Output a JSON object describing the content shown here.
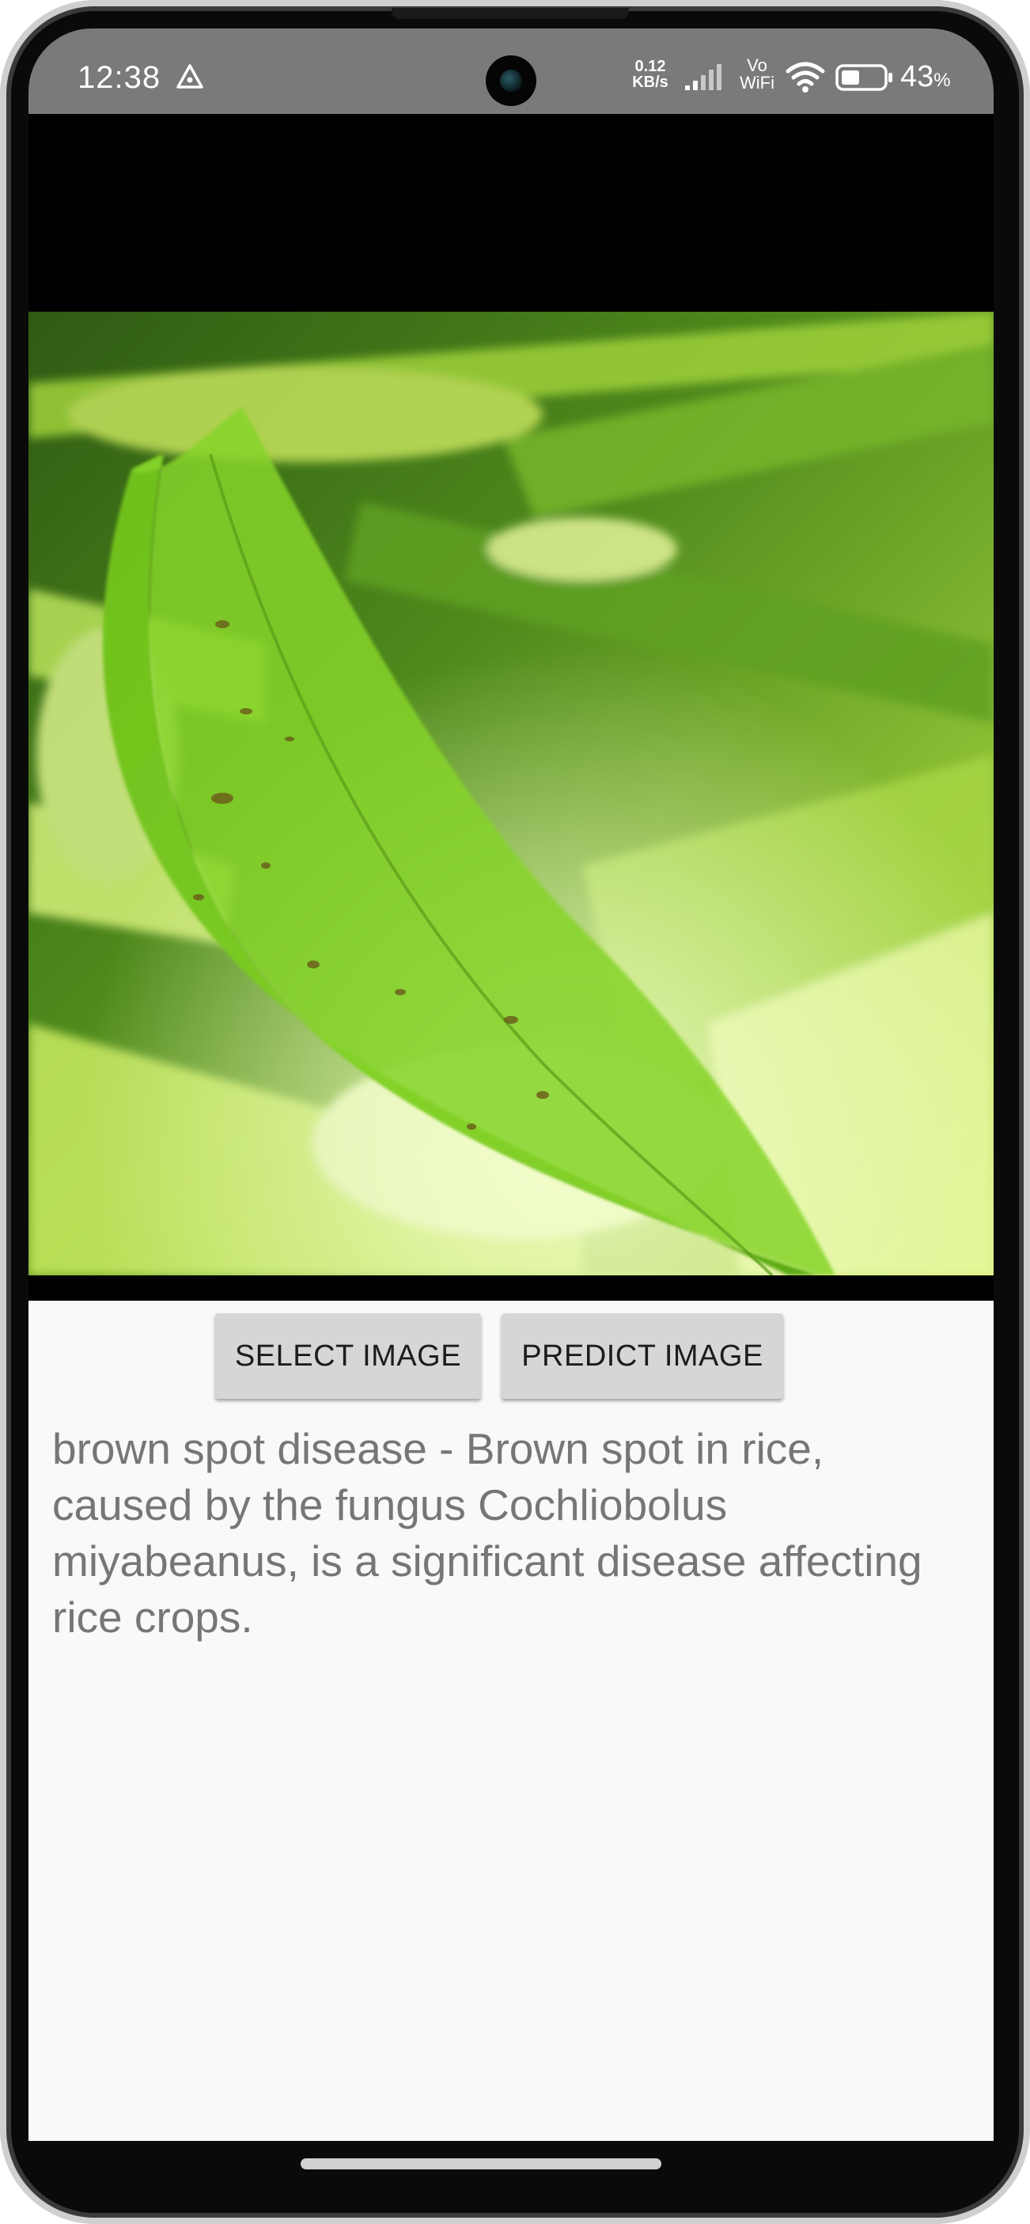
{
  "status_bar": {
    "time": "12:38",
    "network_speed_value": "0.12",
    "network_speed_unit": "KB/s",
    "vowifi_top": "Vo",
    "vowifi_bottom": "WiFi",
    "battery_percent": "43",
    "battery_percent_sign": "%",
    "battery_level": 0.43,
    "icons": [
      "alert-triangle-icon",
      "signal-icon",
      "wifi-icon",
      "battery-icon"
    ]
  },
  "image_preview": {
    "subject": "rice leaf photo"
  },
  "actions": {
    "select_label": "SELECT IMAGE",
    "predict_label": "PREDICT IMAGE"
  },
  "result": {
    "text": "brown spot disease - Brown spot in rice, caused by the fungus Cochliobolus miyabeanus, is a significant disease affecting rice crops."
  },
  "colors": {
    "status_bar_bg": "#7a7a7a",
    "button_bg": "#d6d6d6",
    "result_text": "#767676",
    "content_bg": "#f9f9f9"
  }
}
